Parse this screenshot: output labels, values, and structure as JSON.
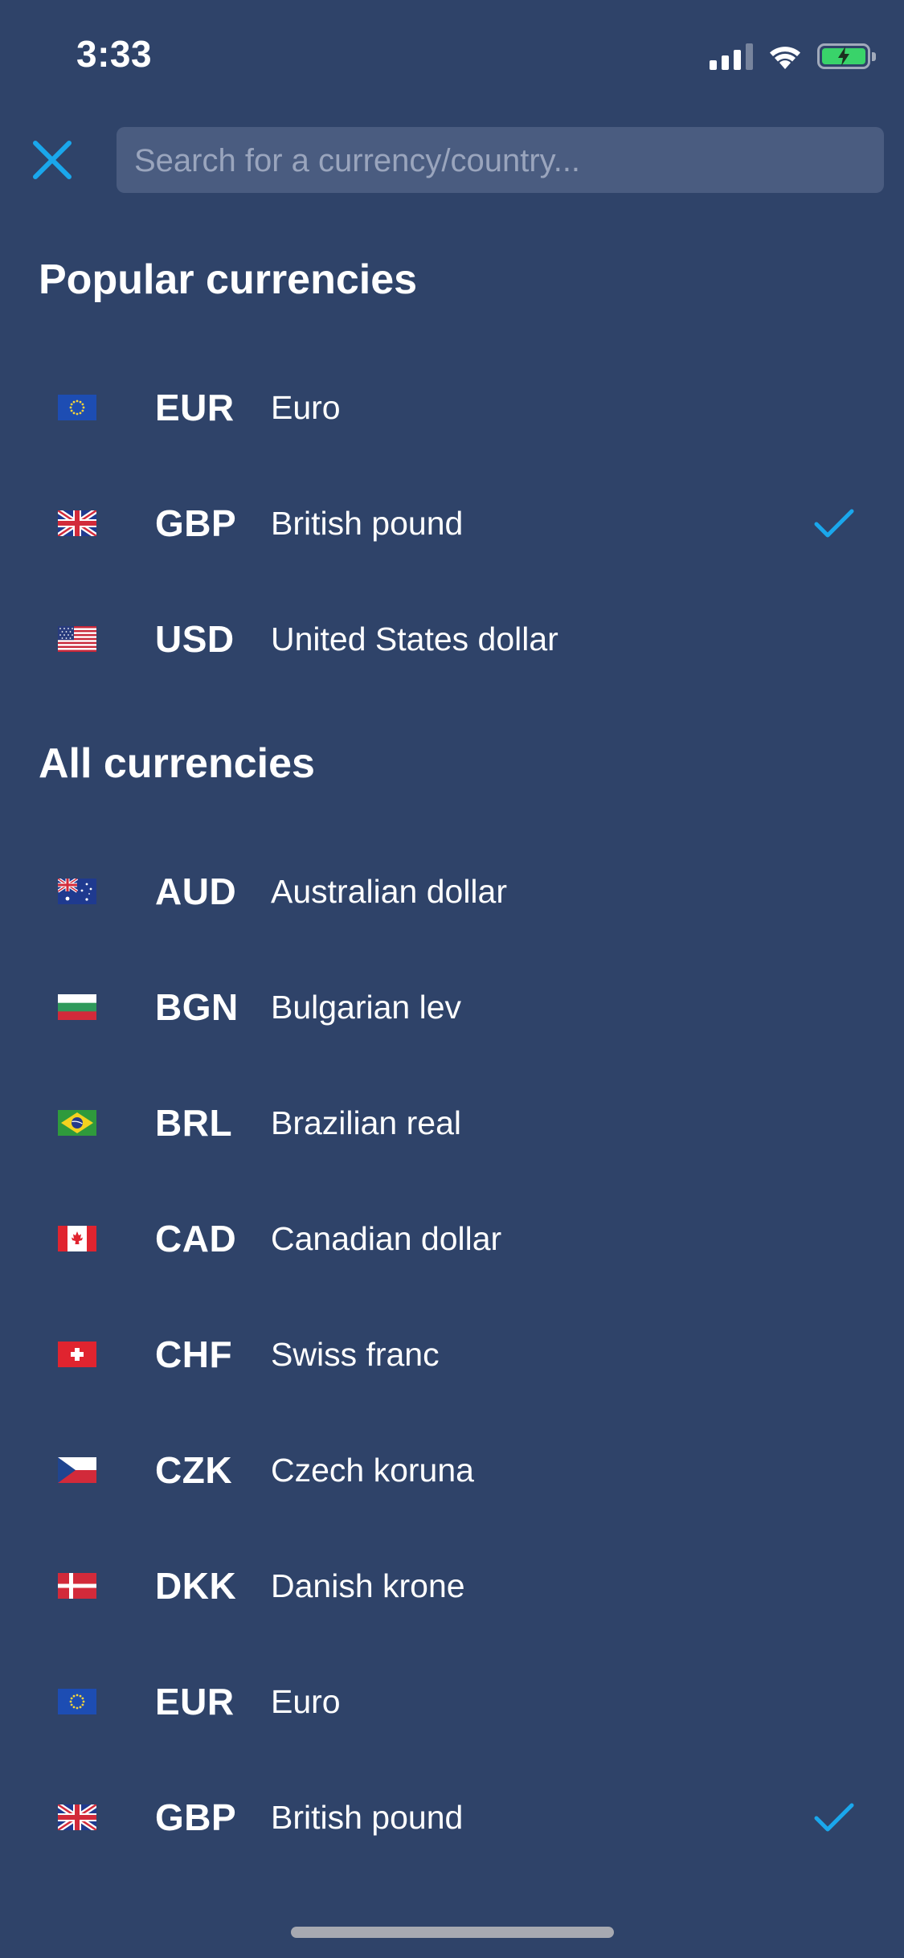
{
  "status_bar": {
    "time": "3:33"
  },
  "header": {
    "close_icon": "close-icon",
    "search_placeholder": "Search for a currency/country..."
  },
  "popular": {
    "title": "Popular currencies",
    "items": [
      {
        "flag": "eu-flag-icon",
        "code": "EUR",
        "name": "Euro",
        "selected": false
      },
      {
        "flag": "gb-flag-icon",
        "code": "GBP",
        "name": "British pound",
        "selected": true
      },
      {
        "flag": "us-flag-icon",
        "code": "USD",
        "name": "United States dollar",
        "selected": false
      }
    ]
  },
  "all": {
    "title": "All currencies",
    "items": [
      {
        "flag": "au-flag-icon",
        "code": "AUD",
        "name": "Australian dollar",
        "selected": false
      },
      {
        "flag": "bg-flag-icon",
        "code": "BGN",
        "name": "Bulgarian lev",
        "selected": false
      },
      {
        "flag": "br-flag-icon",
        "code": "BRL",
        "name": "Brazilian real",
        "selected": false
      },
      {
        "flag": "ca-flag-icon",
        "code": "CAD",
        "name": "Canadian dollar",
        "selected": false
      },
      {
        "flag": "ch-flag-icon",
        "code": "CHF",
        "name": "Swiss franc",
        "selected": false
      },
      {
        "flag": "cz-flag-icon",
        "code": "CZK",
        "name": "Czech koruna",
        "selected": false
      },
      {
        "flag": "dk-flag-icon",
        "code": "DKK",
        "name": "Danish krone",
        "selected": false
      },
      {
        "flag": "eu-flag-icon",
        "code": "EUR",
        "name": "Euro",
        "selected": false
      },
      {
        "flag": "gb-flag-icon",
        "code": "GBP",
        "name": "British pound",
        "selected": true
      }
    ]
  },
  "colors": {
    "background": "#2f4369",
    "search_background": "#4a5c80",
    "accent": "#1aa7ec",
    "text": "#ffffff"
  }
}
